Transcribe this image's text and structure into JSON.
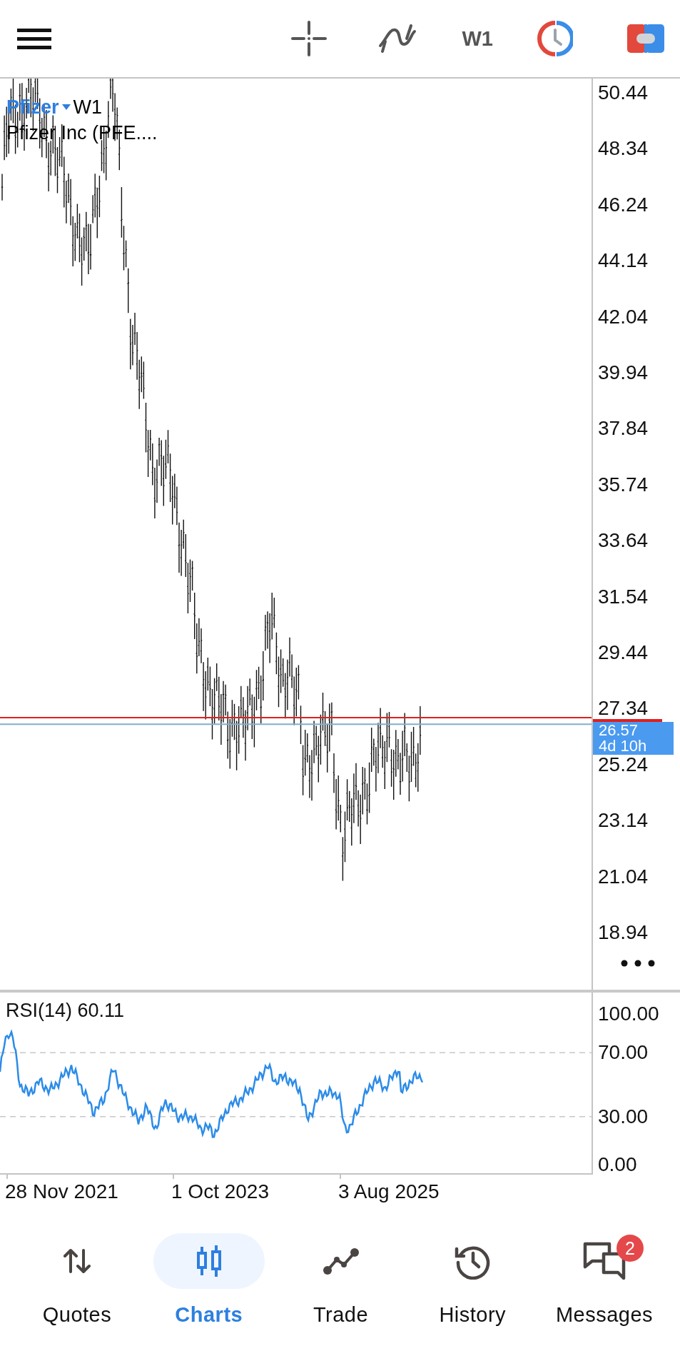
{
  "toolbar": {
    "timeframe": "W1"
  },
  "chart": {
    "symbol": "Pfizer",
    "timeframe": "W1",
    "description": "Pfizer Inc (PFE....",
    "price_labels": [
      "50.44",
      "48.34",
      "46.24",
      "44.14",
      "42.04",
      "39.94",
      "37.84",
      "35.74",
      "33.64",
      "31.54",
      "29.44",
      "27.34",
      "25.24",
      "23.14",
      "21.04",
      "18.94"
    ],
    "current_price": "26.57",
    "time_left": "4d 10h"
  },
  "rsi": {
    "label": "RSI(14) 60.11",
    "levels": [
      "100.00",
      "70.00",
      "30.00",
      "0.00"
    ]
  },
  "date_labels": [
    "28 Nov 2021",
    "1 Oct 2023",
    "3 Aug 2025"
  ],
  "nav": [
    {
      "kind": "quotes",
      "label": "Quotes",
      "selected": false
    },
    {
      "kind": "charts",
      "label": "Charts",
      "selected": true
    },
    {
      "kind": "trade",
      "label": "Trade",
      "selected": false
    },
    {
      "kind": "history",
      "label": "History",
      "selected": false
    },
    {
      "kind": "messages",
      "label": "Messages",
      "selected": false,
      "badge": "2"
    }
  ]
}
